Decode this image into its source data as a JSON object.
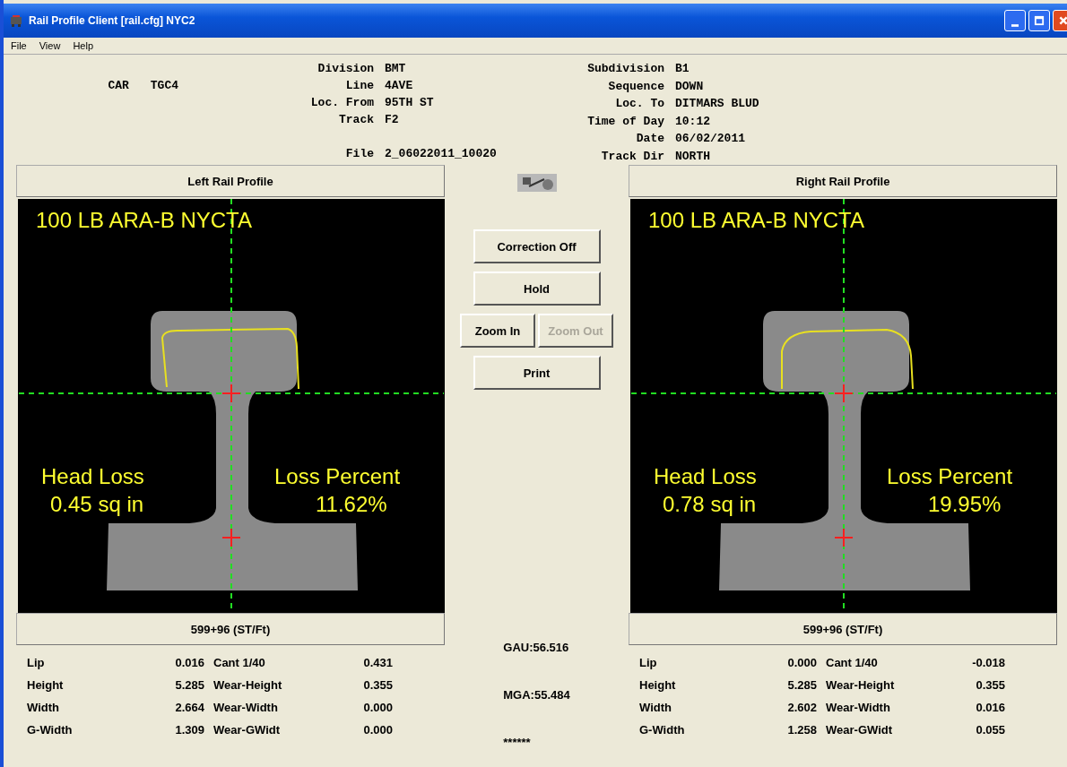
{
  "window": {
    "title": "Rail Profile Client [rail.cfg] NYC2"
  },
  "menu": [
    "File",
    "View",
    "Help"
  ],
  "header": {
    "car_label": "CAR",
    "car": "TGC4",
    "left_fields": [
      {
        "label": "Division",
        "value": "BMT"
      },
      {
        "label": "Line",
        "value": "4AVE"
      },
      {
        "label": "Loc. From",
        "value": "95TH ST"
      },
      {
        "label": "Track",
        "value": "F2"
      }
    ],
    "file_label": "File",
    "file": "2_06022011_10020",
    "right_fields": [
      {
        "label": "Subdivision",
        "value": "B1"
      },
      {
        "label": "Sequence",
        "value": "DOWN"
      },
      {
        "label": "Loc. To",
        "value": "DITMARS BLUD"
      },
      {
        "label": "Time of Day",
        "value": "10:12"
      },
      {
        "label": "Date",
        "value": "06/02/2011"
      },
      {
        "label": "Track Dir",
        "value": "NORTH"
      }
    ]
  },
  "panels": [
    {
      "title": "Left Rail Profile",
      "rail_name": "100 LB ARA-B NYCTA",
      "head_loss_label": "Head Loss",
      "head_loss": "0.45 sq in",
      "loss_percent_label": "Loss Percent",
      "loss_percent": "11.62%",
      "station": "599+96 (ST/Ft)",
      "stats": [
        [
          "Lip",
          "0.016",
          "Cant 1/40",
          "0.431"
        ],
        [
          "Height",
          "5.285",
          "Wear-Height",
          "0.355"
        ],
        [
          "Width",
          "2.664",
          "Wear-Width",
          "0.000"
        ],
        [
          "G-Width",
          "1.309",
          "Wear-GWidt",
          "0.000"
        ]
      ]
    },
    {
      "title": "Right Rail Profile",
      "rail_name": "100 LB ARA-B NYCTA",
      "head_loss_label": "Head Loss",
      "head_loss": "0.78 sq in",
      "loss_percent_label": "Loss Percent",
      "loss_percent": "19.95%",
      "station": "599+96 (ST/Ft)",
      "stats": [
        [
          "Lip",
          "0.000",
          "Cant 1/40",
          "-0.018"
        ],
        [
          "Height",
          "5.285",
          "Wear-Height",
          "0.355"
        ],
        [
          "Width",
          "2.602",
          "Wear-Width",
          "0.016"
        ],
        [
          "G-Width",
          "1.258",
          "Wear-GWidt",
          "0.055"
        ]
      ]
    }
  ],
  "controls": [
    {
      "label": "Correction Off",
      "disabled": false,
      "kind": "wide"
    },
    {
      "label": "Hold",
      "disabled": false,
      "kind": "wide"
    },
    {
      "label": "Zoom In",
      "disabled": false,
      "kind": "half"
    },
    {
      "label": "Zoom Out",
      "disabled": true,
      "kind": "half"
    },
    {
      "label": "Print",
      "disabled": false,
      "kind": "wide"
    }
  ],
  "readouts": [
    "GAU:56.516",
    "MGA:55.484",
    "******"
  ]
}
